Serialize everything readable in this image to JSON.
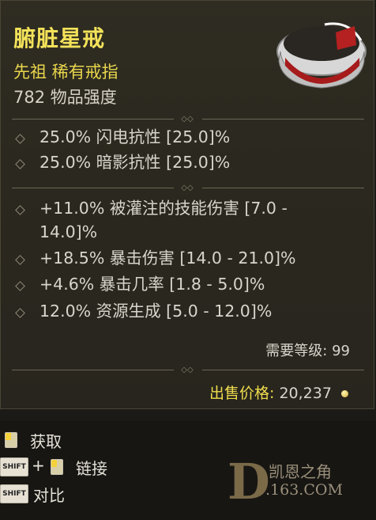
{
  "item": {
    "name": "腑脏星戒",
    "type": "先祖 稀有戒指",
    "power": "782 物品强度"
  },
  "resistances": [
    "25.0% 闪电抗性 [25.0]%",
    "25.0% 暗影抗性 [25.0]%"
  ],
  "affixes": [
    {
      "line1": "+11.0% 被灌注的技能伤害 [7.0 -",
      "line2": "14.0]%"
    },
    {
      "line1": "+18.5% 暴击伤害 [14.0 - 21.0]%"
    },
    {
      "line1": "+4.6% 暴击几率 [1.8 - 5.0]%"
    },
    {
      "line1": "12.0% 资源生成 [5.0 - 12.0]%"
    }
  ],
  "requirement": "需要等级: 99",
  "price": {
    "label": "出售价格:",
    "value": "20,237"
  },
  "actions": {
    "acquire": "获取",
    "link": "链接",
    "compare": "对比",
    "shift": "SHIFT",
    "plus": "+"
  },
  "watermark": {
    "mark": "D",
    "name": "凯恩之角",
    "domain": ".163.COM"
  },
  "colors": {
    "title": "#f3e25a",
    "text": "#d8d5cc",
    "panel": "#2d2a21"
  }
}
